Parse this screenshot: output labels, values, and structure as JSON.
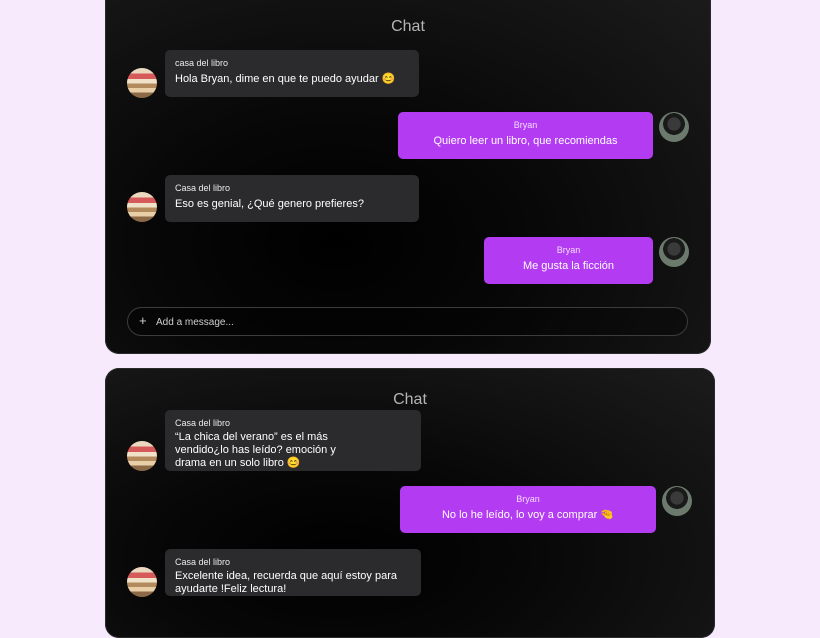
{
  "panel1": {
    "title": "Chat",
    "messages": [
      {
        "sender": "casa del libro",
        "text": "Hola Bryan, dime en que te puedo ayudar 😊"
      },
      {
        "sender": "Bryan",
        "text": "Quiero leer un libro, que recomiendas"
      },
      {
        "sender": "Casa del libro",
        "text": "Eso es genial, ¿Qué genero prefieres?"
      },
      {
        "sender": "Bryan",
        "text": "Me gusta la ficción"
      }
    ],
    "composer": {
      "placeholder": "Add a message...",
      "plus": "+"
    }
  },
  "panel2": {
    "title": "Chat",
    "messages": [
      {
        "sender": "Casa del libro",
        "text": "“La chica del verano” es el más\nvendido¿lo has leído? emoción y\ndrama en un solo libro 😊"
      },
      {
        "sender": "Bryan",
        "text": "No lo he leído, lo voy a comprar 🤏"
      },
      {
        "sender": "Casa del libro",
        "text": "Excelente idea, recuerda que aquí estoy para\n ayudarte !Feliz lectura!"
      }
    ]
  },
  "colors": {
    "accent": "#b33cf2",
    "bot_bubble": "#2b2b2d",
    "background": "#f6eafc"
  }
}
